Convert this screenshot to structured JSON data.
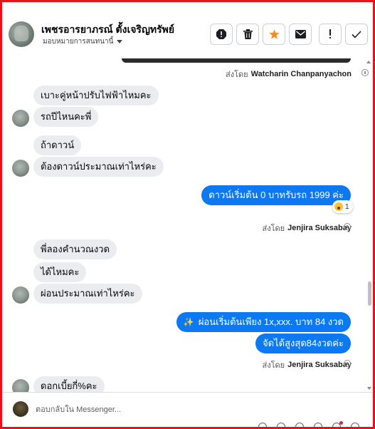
{
  "header": {
    "title": "เพชรอารยาภรณ์ ตั้งเจริญทรัพย์",
    "assign_label": "มอบหมายการสนทนานี้",
    "actions": [
      {
        "name": "spam-icon"
      },
      {
        "name": "trash-icon"
      },
      {
        "name": "star-icon",
        "color": "#f28c28"
      },
      {
        "name": "mail-icon"
      },
      {
        "name": "alert-icon"
      },
      {
        "name": "check-icon"
      }
    ]
  },
  "messages": {
    "sent_by_1": {
      "prefix": "ส่งโดย",
      "name": "Watcharin Chanpanyachon"
    },
    "m1": "เบาะคู่หน้าปรับไฟฟ้าไหมคะ",
    "m2": "รถปีไหนคะพี่",
    "m3": "ถ้าดาวน์",
    "m4": "ต้องดาวน์ประมาณเท่าไหร่คะ",
    "r1": "ดาวน์เริ่มต้น 0 บาทรับรถ 1999 ค่ะ",
    "r1_reaction_count": "1",
    "sent_by_2": {
      "prefix": "ส่งโดย",
      "name": "Jenjira Suksabay"
    },
    "m5": "พี่ลองคำนวณงวด",
    "m6": "ได้ไหมคะ",
    "m7": "ผ่อนประมาณเท่าไหร่คะ",
    "r2_icon": "✨",
    "r2": "ผ่อนเริ่มต้นเพียง 1x,xxx. บาท 84 งวด",
    "r3": "จัดได้สูงสุด84งวดค่ะ",
    "sent_by_3": {
      "prefix": "ส่งโดย",
      "name": "Jenjira Suksabay"
    },
    "m8": "ดอกเบี้ยกี่%คะ"
  },
  "composer": {
    "placeholder": "ตอบกลับใน Messenger..."
  },
  "colors": {
    "outgoing": "#0c79f2",
    "incoming": "#eaecf0",
    "border": "#e8121b"
  }
}
